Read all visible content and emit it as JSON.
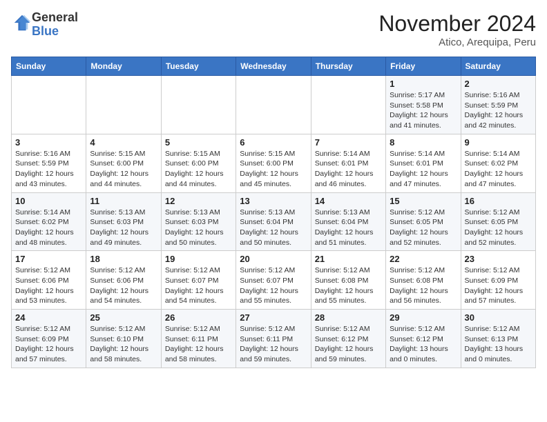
{
  "header": {
    "logo_general": "General",
    "logo_blue": "Blue",
    "title": "November 2024",
    "subtitle": "Atico, Arequipa, Peru"
  },
  "weekdays": [
    "Sunday",
    "Monday",
    "Tuesday",
    "Wednesday",
    "Thursday",
    "Friday",
    "Saturday"
  ],
  "weeks": [
    [
      {
        "day": "",
        "info": ""
      },
      {
        "day": "",
        "info": ""
      },
      {
        "day": "",
        "info": ""
      },
      {
        "day": "",
        "info": ""
      },
      {
        "day": "",
        "info": ""
      },
      {
        "day": "1",
        "info": "Sunrise: 5:17 AM\nSunset: 5:58 PM\nDaylight: 12 hours\nand 41 minutes."
      },
      {
        "day": "2",
        "info": "Sunrise: 5:16 AM\nSunset: 5:59 PM\nDaylight: 12 hours\nand 42 minutes."
      }
    ],
    [
      {
        "day": "3",
        "info": "Sunrise: 5:16 AM\nSunset: 5:59 PM\nDaylight: 12 hours\nand 43 minutes."
      },
      {
        "day": "4",
        "info": "Sunrise: 5:15 AM\nSunset: 6:00 PM\nDaylight: 12 hours\nand 44 minutes."
      },
      {
        "day": "5",
        "info": "Sunrise: 5:15 AM\nSunset: 6:00 PM\nDaylight: 12 hours\nand 44 minutes."
      },
      {
        "day": "6",
        "info": "Sunrise: 5:15 AM\nSunset: 6:00 PM\nDaylight: 12 hours\nand 45 minutes."
      },
      {
        "day": "7",
        "info": "Sunrise: 5:14 AM\nSunset: 6:01 PM\nDaylight: 12 hours\nand 46 minutes."
      },
      {
        "day": "8",
        "info": "Sunrise: 5:14 AM\nSunset: 6:01 PM\nDaylight: 12 hours\nand 47 minutes."
      },
      {
        "day": "9",
        "info": "Sunrise: 5:14 AM\nSunset: 6:02 PM\nDaylight: 12 hours\nand 47 minutes."
      }
    ],
    [
      {
        "day": "10",
        "info": "Sunrise: 5:14 AM\nSunset: 6:02 PM\nDaylight: 12 hours\nand 48 minutes."
      },
      {
        "day": "11",
        "info": "Sunrise: 5:13 AM\nSunset: 6:03 PM\nDaylight: 12 hours\nand 49 minutes."
      },
      {
        "day": "12",
        "info": "Sunrise: 5:13 AM\nSunset: 6:03 PM\nDaylight: 12 hours\nand 50 minutes."
      },
      {
        "day": "13",
        "info": "Sunrise: 5:13 AM\nSunset: 6:04 PM\nDaylight: 12 hours\nand 50 minutes."
      },
      {
        "day": "14",
        "info": "Sunrise: 5:13 AM\nSunset: 6:04 PM\nDaylight: 12 hours\nand 51 minutes."
      },
      {
        "day": "15",
        "info": "Sunrise: 5:12 AM\nSunset: 6:05 PM\nDaylight: 12 hours\nand 52 minutes."
      },
      {
        "day": "16",
        "info": "Sunrise: 5:12 AM\nSunset: 6:05 PM\nDaylight: 12 hours\nand 52 minutes."
      }
    ],
    [
      {
        "day": "17",
        "info": "Sunrise: 5:12 AM\nSunset: 6:06 PM\nDaylight: 12 hours\nand 53 minutes."
      },
      {
        "day": "18",
        "info": "Sunrise: 5:12 AM\nSunset: 6:06 PM\nDaylight: 12 hours\nand 54 minutes."
      },
      {
        "day": "19",
        "info": "Sunrise: 5:12 AM\nSunset: 6:07 PM\nDaylight: 12 hours\nand 54 minutes."
      },
      {
        "day": "20",
        "info": "Sunrise: 5:12 AM\nSunset: 6:07 PM\nDaylight: 12 hours\nand 55 minutes."
      },
      {
        "day": "21",
        "info": "Sunrise: 5:12 AM\nSunset: 6:08 PM\nDaylight: 12 hours\nand 55 minutes."
      },
      {
        "day": "22",
        "info": "Sunrise: 5:12 AM\nSunset: 6:08 PM\nDaylight: 12 hours\nand 56 minutes."
      },
      {
        "day": "23",
        "info": "Sunrise: 5:12 AM\nSunset: 6:09 PM\nDaylight: 12 hours\nand 57 minutes."
      }
    ],
    [
      {
        "day": "24",
        "info": "Sunrise: 5:12 AM\nSunset: 6:09 PM\nDaylight: 12 hours\nand 57 minutes."
      },
      {
        "day": "25",
        "info": "Sunrise: 5:12 AM\nSunset: 6:10 PM\nDaylight: 12 hours\nand 58 minutes."
      },
      {
        "day": "26",
        "info": "Sunrise: 5:12 AM\nSunset: 6:11 PM\nDaylight: 12 hours\nand 58 minutes."
      },
      {
        "day": "27",
        "info": "Sunrise: 5:12 AM\nSunset: 6:11 PM\nDaylight: 12 hours\nand 59 minutes."
      },
      {
        "day": "28",
        "info": "Sunrise: 5:12 AM\nSunset: 6:12 PM\nDaylight: 12 hours\nand 59 minutes."
      },
      {
        "day": "29",
        "info": "Sunrise: 5:12 AM\nSunset: 6:12 PM\nDaylight: 13 hours\nand 0 minutes."
      },
      {
        "day": "30",
        "info": "Sunrise: 5:12 AM\nSunset: 6:13 PM\nDaylight: 13 hours\nand 0 minutes."
      }
    ]
  ]
}
